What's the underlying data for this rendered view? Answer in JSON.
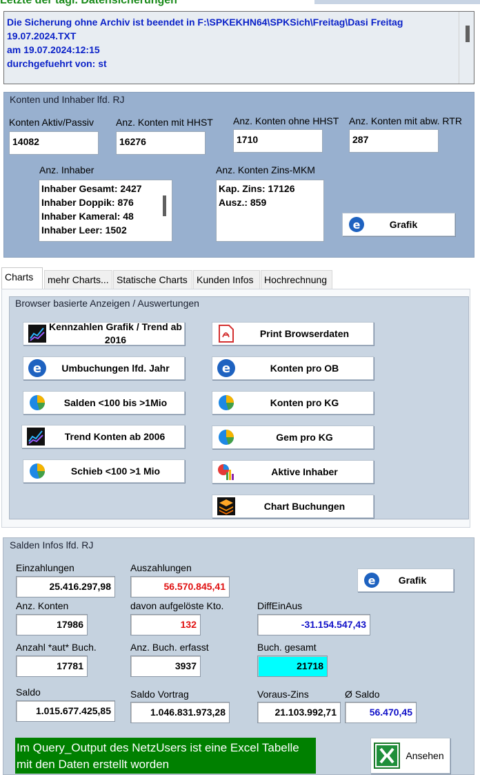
{
  "header": {
    "title_cut": "Letzte der tägl. Datensicherungen",
    "log_lines": [
      "Die Sicherung ohne Archiv ist beendet in F:\\SPKEKHN64\\SPKSich\\Freitag\\Dasi Freitag",
      "19.07.2024.TXT",
      "am 19.07.2024:12:15",
      "durchgefuehrt von:  st"
    ]
  },
  "konten": {
    "title": "Konten und Inhaber lfd. RJ",
    "fields": [
      {
        "label": "Konten Aktiv/Passiv",
        "value": "14082"
      },
      {
        "label": "Anz. Konten mit HHST",
        "value": "16276"
      },
      {
        "label": "Anz. Konten ohne HHST",
        "value": "1710"
      },
      {
        "label": "Anz. Konten mit abw. RTR",
        "value": "287"
      }
    ],
    "inhaber_label": "Anz. Inhaber",
    "inhaber_list": [
      "Inhaber Gesamt:  2427",
      "Inhaber Doppik:  876",
      "Inhaber Kameral:  48",
      "Inhaber Leer:  1502"
    ],
    "zins_label": "Anz. Konten Zins-MKM",
    "zins_list": [
      "Kap. Zins: 17126",
      "Ausz.: 859"
    ],
    "grafik_label": "Grafik"
  },
  "tabs": [
    {
      "label": "Charts",
      "active": true
    },
    {
      "label": "mehr Charts...",
      "active": false
    },
    {
      "label": "Statische Charts",
      "active": false
    },
    {
      "label": "Kunden Infos",
      "active": false
    },
    {
      "label": "Hochrechnung",
      "active": false
    }
  ],
  "browser": {
    "title": "Browser basierte Anzeigen / Auswertungen",
    "left_buttons": [
      {
        "label": "Kennzahlen Grafik / Trend ab 2016",
        "icon": "trend-chart-icon"
      },
      {
        "label": "Umbuchungen lfd. Jahr",
        "icon": "browser-e-icon"
      },
      {
        "label": "Salden <100 bis >1Mio",
        "icon": "pie-chart-icon"
      },
      {
        "label": "Trend Konten ab 2006",
        "icon": "trend-chart-icon"
      },
      {
        "label": "Schieb <100 >1 Mio",
        "icon": "pie-chart-icon"
      }
    ],
    "right_buttons": [
      {
        "label": "Print Browserdaten",
        "icon": "pdf-icon"
      },
      {
        "label": "Konten pro OB",
        "icon": "browser-e-icon"
      },
      {
        "label": "Konten pro KG",
        "icon": "pie-chart-icon"
      },
      {
        "label": "Gem pro KG",
        "icon": "pie-chart-icon"
      },
      {
        "label": "Aktive Inhaber",
        "icon": "bar-pie-chart-icon"
      },
      {
        "label": "Chart Buchungen",
        "icon": "layers-icon"
      }
    ]
  },
  "salden": {
    "title": "Salden Infos lfd. RJ",
    "einzahlungen_label": "Einzahlungen",
    "einzahlungen": "25.416.297,98",
    "auszahlungen_label": "Auszahlungen",
    "auszahlungen": "56.570.845,41",
    "grafik_label": "Grafik",
    "anz_konten_label": "Anz. Konten",
    "anz_konten": "17986",
    "aufgeloest_label": "davon aufgelöste Kto.",
    "aufgeloest": "132",
    "diff_label": "DiffEinAus",
    "diff": "-31.154.547,43",
    "aut_label": "Anzahl *aut* Buch.",
    "aut": "17781",
    "erfasst_label": "Anz. Buch. erfasst",
    "erfasst": "3937",
    "gesamt_label": "Buch. gesamt",
    "gesamt": "21718",
    "saldo_label": "Saldo",
    "saldo": "1.015.677.425,85",
    "vortrag_label": "Saldo Vortrag",
    "vortrag": "1.046.831.973,28",
    "zins_label": "Voraus-Zins",
    "zins": "21.103.992,71",
    "avg_label": "Ø Saldo",
    "avg": "56.470,45",
    "excel_note": "Im Query_Output des NetzUsers ist eine Excel Tabelle mit den Daten erstellt worden",
    "ansehen_label": "Ansehen"
  },
  "colors": {
    "log_text": "#0b22c8",
    "panel_blue": "#98b0cf",
    "excel_green": "#008000",
    "highlight_cyan": "#00ffff"
  }
}
